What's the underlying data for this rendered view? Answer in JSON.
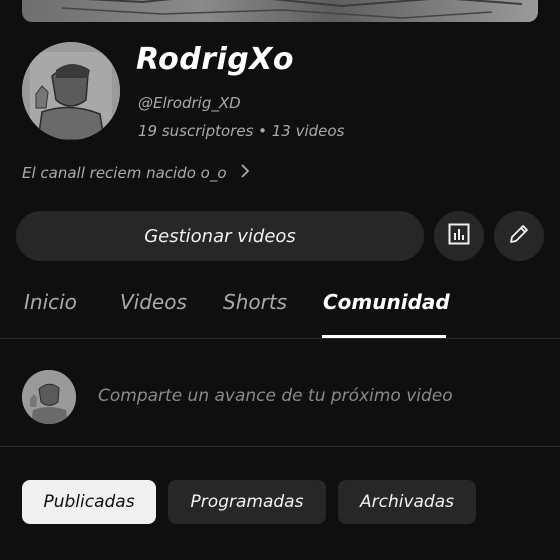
{
  "channel": {
    "name": "RodrigXo",
    "handle": "@Elrodrig_XD",
    "stats": "19 suscriptores • 13 videos",
    "description": "El canall reciem nacido o_o"
  },
  "actions": {
    "manage_videos_label": "Gestionar videos",
    "analytics_icon": "bar-chart-icon",
    "edit_icon": "pencil-icon"
  },
  "tabs": [
    {
      "label": "Inicio",
      "active": false
    },
    {
      "label": "Videos",
      "active": false
    },
    {
      "label": "Shorts",
      "active": false
    },
    {
      "label": "Comunidad",
      "active": true
    }
  ],
  "community": {
    "post_placeholder": "Comparte un avance de tu próximo video",
    "filters": [
      {
        "label": "Publicadas",
        "active": true
      },
      {
        "label": "Programadas",
        "active": false
      },
      {
        "label": "Archivadas",
        "active": false
      }
    ]
  },
  "colors": {
    "background": "#0f0f0f",
    "button_bg": "#272727",
    "active_chip_bg": "#f1f1f1",
    "secondary_text": "#aaaaaa"
  }
}
